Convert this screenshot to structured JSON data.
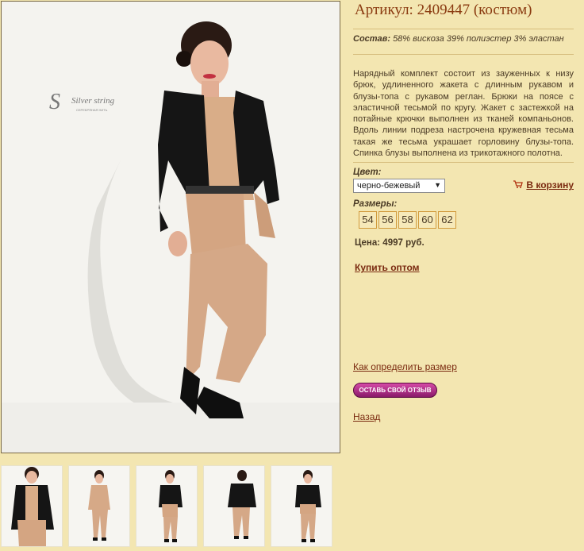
{
  "product": {
    "title": "Артикул: 2409447 (костюм)",
    "composition_label": "Состав:",
    "composition_value": "58% вискоза 39% полиэстер 3% эластан",
    "description": "Нарядный комплект состоит из зауженных к низу брюк, удлиненного жакета с длинным рукавом и блузы-топа с рукавом реглан. Брюки на поясе с эластичной тесьмой по кругу. Жакет с застежкой на потайные крючки выполнен из тканей компаньонов. Вдоль линии подреза настрочена кружевная тесьма такая же тесьма украшает горловину блузы-топа. Спинка блузы выполнена из трикотажного полотна.",
    "color_label": "Цвет:",
    "color_selected": "черно-бежевый",
    "sizes_label": "Размеры:",
    "sizes": [
      "54",
      "56",
      "58",
      "60",
      "62"
    ],
    "price": "Цена: 4997 руб."
  },
  "actions": {
    "add_to_cart": "В корзину",
    "buy_wholesale": "Купить оптом",
    "size_guide": "Как определить размер",
    "leave_review": "ОСТАВЬ СВОЙ ОТЗЫВ",
    "back": "Назад"
  },
  "brand": {
    "logo_text": "Silver string",
    "logo_subtext": "СЕРЕБРЯНАЯ НИТЬ"
  },
  "colors": {
    "background": "#f3e6b1",
    "link": "#7a2a10",
    "title": "#8a3a10",
    "review_button": "#b0307f"
  }
}
